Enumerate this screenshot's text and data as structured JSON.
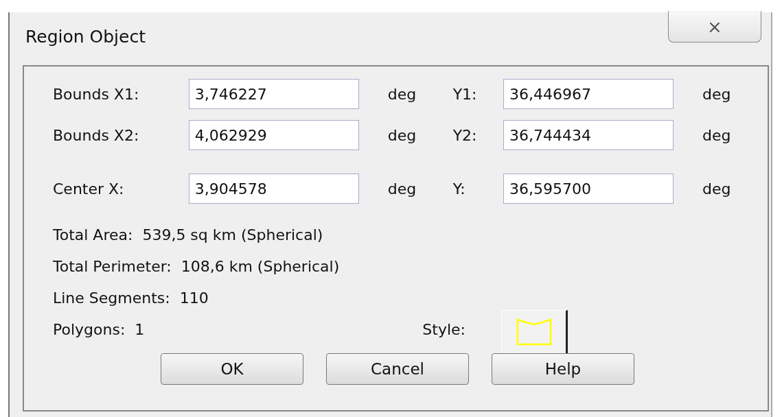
{
  "window": {
    "title": "Region Object",
    "close": "⨯"
  },
  "coordinate_rows": [
    {
      "label": "Bounds X1:",
      "x_value": "3,746227",
      "x_unit": "deg",
      "y_label": "Y1:",
      "y_value": "36,446967",
      "y_unit": "deg"
    },
    {
      "label": "Bounds X2:",
      "x_value": "4,062929",
      "x_unit": "deg",
      "y_label": "Y2:",
      "y_value": "36,744434",
      "y_unit": "deg"
    },
    {
      "label": "Center X:",
      "x_value": "3,904578",
      "x_unit": "deg",
      "y_label": "Y:",
      "y_value": "36,595700",
      "y_unit": "deg"
    }
  ],
  "info_lines": [
    "Total Area:  539,5 sq km (Spherical)",
    "Total Perimeter:  108,6 km (Spherical)",
    "Line Segments:  110",
    "Polygons:  1"
  ],
  "style": {
    "label": "Style:"
  },
  "buttons": [
    "OK",
    "Cancel",
    "Help"
  ]
}
